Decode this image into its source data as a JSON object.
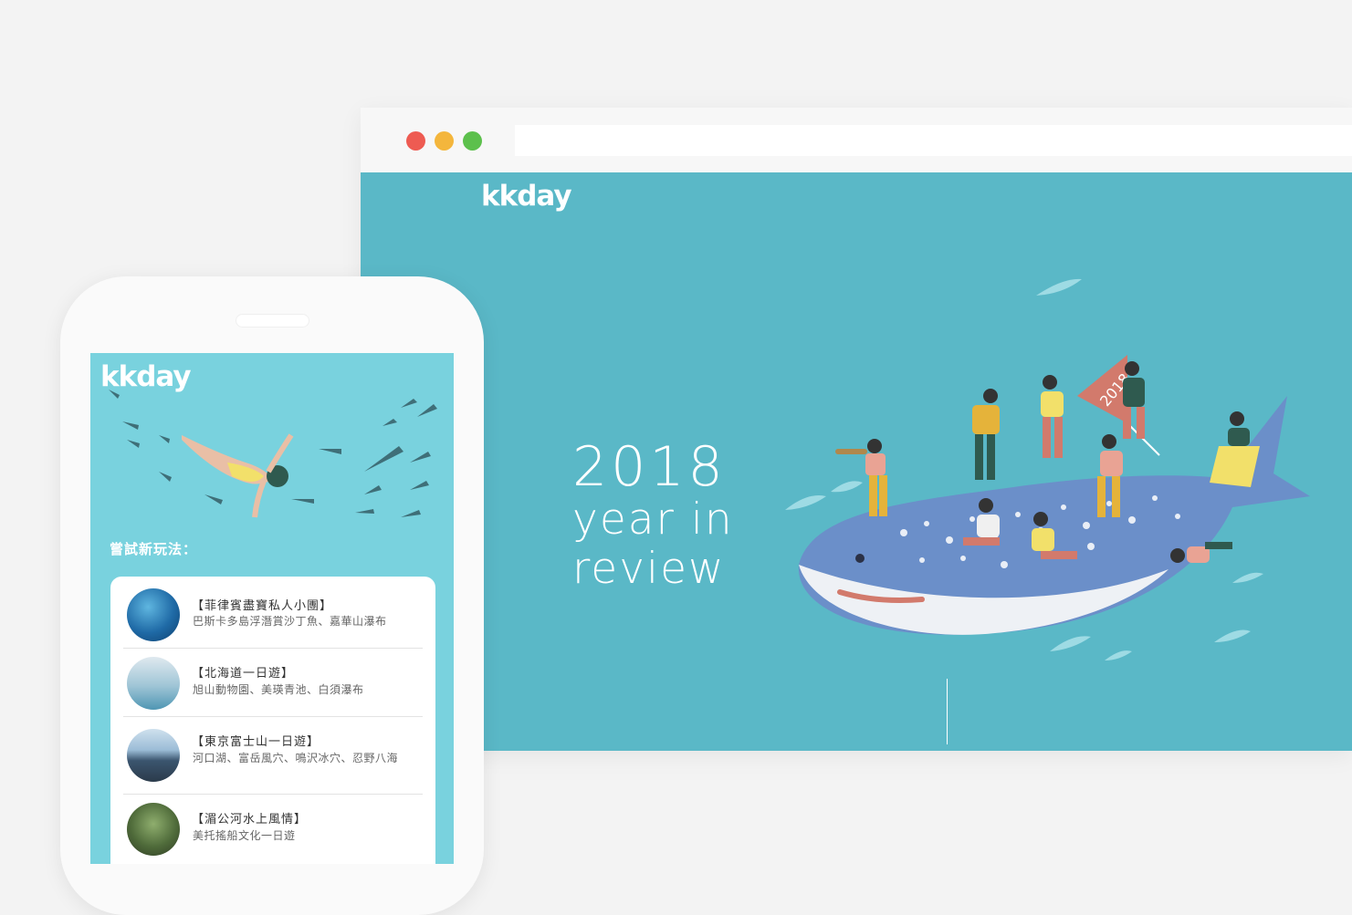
{
  "colors": {
    "page_bg": "#f3f3f3",
    "desktop_teal": "#5ab8c7",
    "mobile_teal": "#79d2de",
    "whale_blue": "#6b8fc9",
    "flag": "#d27a6c"
  },
  "desktop": {
    "brand": "kkday",
    "headline": {
      "line1": "2018",
      "line2": "year in",
      "line3": "review"
    },
    "flag_text": "2018"
  },
  "mobile": {
    "brand": "kkday",
    "section_title": "嘗試新玩法：",
    "items": [
      {
        "title": "【菲律賓盡寶私人小團】",
        "desc": "巴斯卡多島浮潛賞沙丁魚、嘉華山瀑布",
        "thumb_icon": "ocean-photo-icon"
      },
      {
        "title": "【北海道一日遊】",
        "desc": "旭山動物園、美瑛青池、白須瀑布",
        "thumb_icon": "lake-photo-icon"
      },
      {
        "title": "【東京富士山一日遊】",
        "desc": "河口湖、富岳風穴、鳴沢冰穴、忍野八海",
        "thumb_icon": "mountain-photo-icon"
      },
      {
        "title": "【湄公河水上風情】",
        "desc": "美托搖船文化一日遊",
        "thumb_icon": "river-boat-photo-icon"
      }
    ]
  }
}
